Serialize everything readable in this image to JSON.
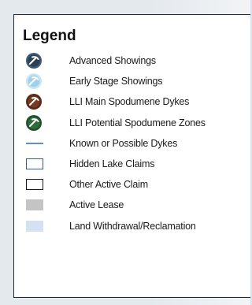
{
  "legend": {
    "title": "Legend",
    "items": [
      {
        "label": "Advanced Showings",
        "symbol": "dark-navy-mine-icon",
        "fill": "#2d3e50",
        "ring": "#3a5a78"
      },
      {
        "label": "Early Stage Showings",
        "symbol": "light-blue-mine-icon",
        "fill": "#9fd1ea",
        "ring": "#c8e6f3"
      },
      {
        "label": "LLI Main Spodumene Dykes",
        "symbol": "brown-mine-icon",
        "fill": "#7a3a21",
        "ring": "#5a2a18"
      },
      {
        "label": "LLI Potential Spodumene Zones",
        "symbol": "green-mine-icon",
        "fill": "#2f6b3c",
        "ring": "#23512d"
      },
      {
        "label": "Known or Possible Dykes",
        "symbol": "blue-line",
        "color": "#5b8fd6"
      },
      {
        "label": "Hidden Lake Claims",
        "symbol": "blue-outline-box",
        "color": "#2f5f9a"
      },
      {
        "label": "Other Active Claim",
        "symbol": "black-outline-box",
        "color": "#1a1a1a"
      },
      {
        "label": "Active Lease",
        "symbol": "grey-filled-box",
        "color": "#c4c4c4"
      },
      {
        "label": "Land Withdrawal/Reclamation",
        "symbol": "light-blue-filled-box",
        "color": "#d3e1f3"
      }
    ]
  }
}
